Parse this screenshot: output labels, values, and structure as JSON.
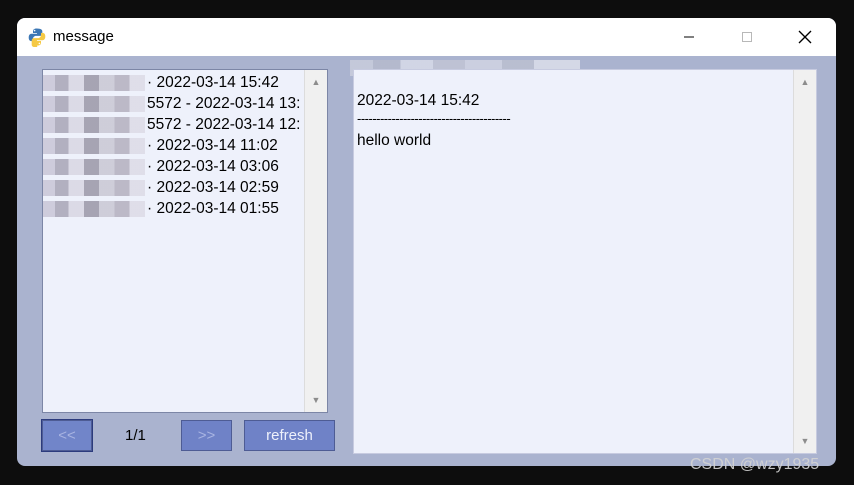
{
  "window": {
    "title": "message",
    "app_icon": "python-icon"
  },
  "list": {
    "items": [
      {
        "text": "· 2022-03-14 15:42"
      },
      {
        "text": "5572 - 2022-03-14 13:"
      },
      {
        "text": "5572 - 2022-03-14 12:"
      },
      {
        "text": "· 2022-03-14 11:02"
      },
      {
        "text": "· 2022-03-14 03:06"
      },
      {
        "text": "· 2022-03-14 02:59"
      },
      {
        "text": "· 2022-03-14 01:55"
      }
    ]
  },
  "pager": {
    "prev_label": "<<",
    "page": "1/1",
    "next_label": ">>",
    "refresh_label": "refresh"
  },
  "detail": {
    "timestamp": "2022-03-14 15:42",
    "divider": "----------------------------------------",
    "body": "hello world"
  },
  "watermark": "CSDN @wzy1935",
  "colors": {
    "window_bg": "#aab3cf",
    "panel_bg": "#eef1fb",
    "button": "#6f82c7"
  }
}
